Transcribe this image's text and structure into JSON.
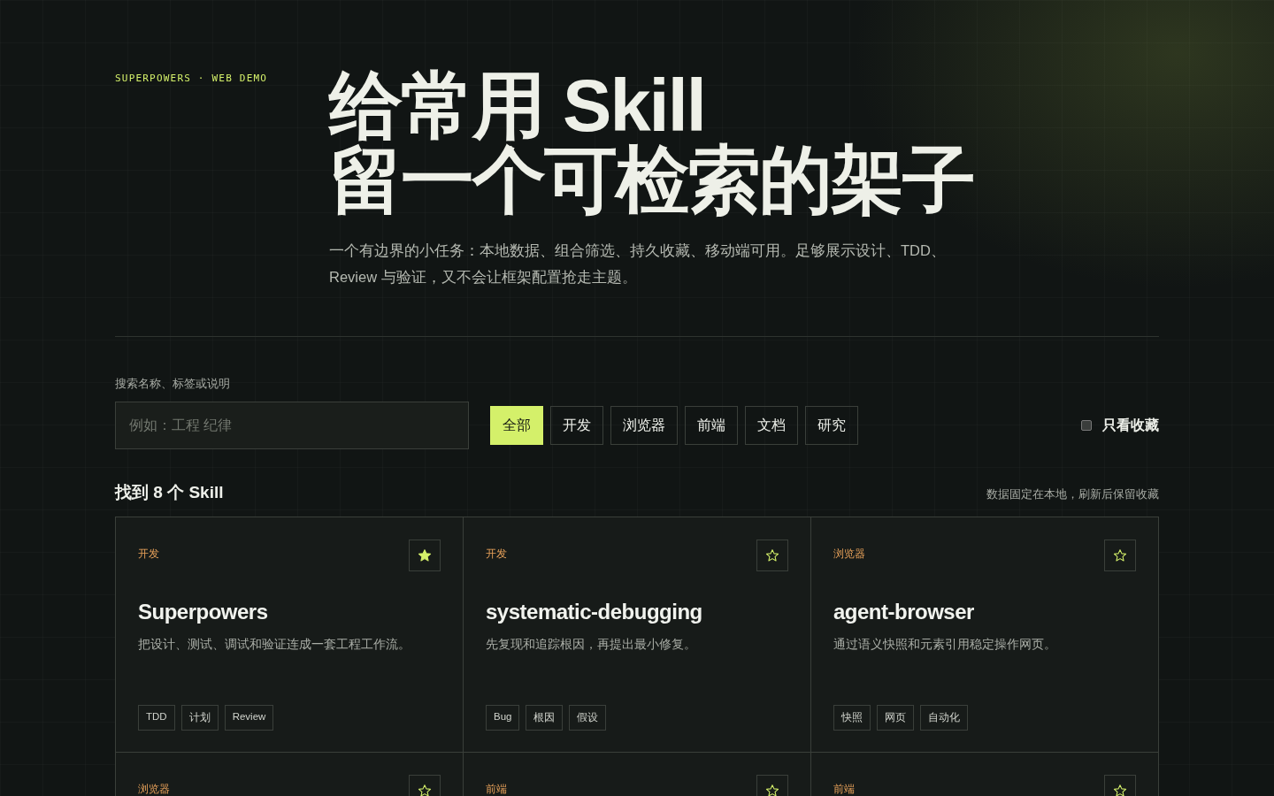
{
  "hero": {
    "eyebrow": "SUPERPOWERS · WEB DEMO",
    "title_lines": [
      "给常用 Skill",
      "留一个可检索的架子"
    ],
    "description": "一个有边界的小任务：本地数据、组合筛选、持久收藏、移动端可用。足够展示设计、TDD、Review 与验证，又不会让框架配置抢走主题。"
  },
  "search": {
    "label": "搜索名称、标签或说明",
    "placeholder": "例如：工程 纪律"
  },
  "filters": [
    {
      "label": "全部",
      "selected": true
    },
    {
      "label": "开发",
      "selected": false
    },
    {
      "label": "浏览器",
      "selected": false
    },
    {
      "label": "前端",
      "selected": false
    },
    {
      "label": "文档",
      "selected": false
    },
    {
      "label": "研究",
      "selected": false
    }
  ],
  "favorites_only": {
    "label": "只看收藏",
    "checked": false
  },
  "results": {
    "count": "找到 8 个 Skill",
    "note": "数据固定在本地，刷新后保留收藏"
  },
  "cards": [
    {
      "category": "开发",
      "favorite": true,
      "name": "Superpowers",
      "description": "把设计、测试、调试和验证连成一套工程工作流。",
      "tags": [
        "TDD",
        "计划",
        "Review"
      ]
    },
    {
      "category": "开发",
      "favorite": false,
      "name": "systematic-debugging",
      "description": "先复现和追踪根因，再提出最小修复。",
      "tags": [
        "Bug",
        "根因",
        "假设"
      ]
    },
    {
      "category": "浏览器",
      "favorite": false,
      "name": "agent-browser",
      "description": "通过语义快照和元素引用稳定操作网页。",
      "tags": [
        "快照",
        "网页",
        "自动化"
      ]
    },
    {
      "category": "浏览器",
      "favorite": false
    },
    {
      "category": "前端",
      "favorite": false
    },
    {
      "category": "前端",
      "favorite": false
    }
  ]
}
